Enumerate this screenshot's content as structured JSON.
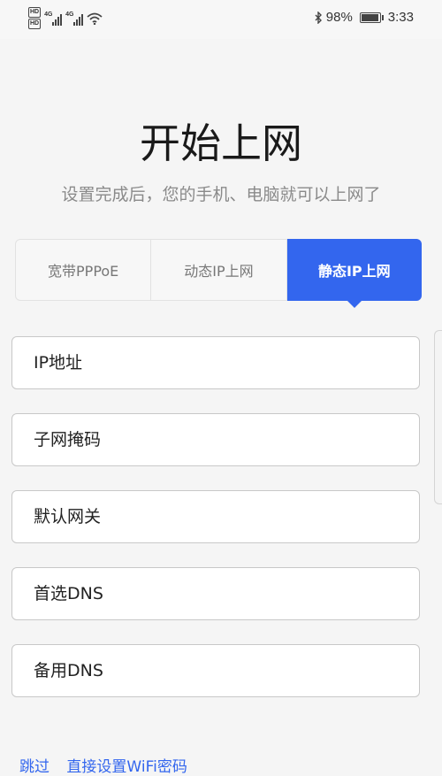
{
  "status_bar": {
    "hd1": "HD",
    "hd2": "HD",
    "net1": "4G",
    "net2": "4G",
    "battery_level": 0.98,
    "battery_text": "98%",
    "time": "3:33"
  },
  "header": {
    "title": "开始上网",
    "subtitle": "设置完成后，您的手机、电脑就可以上网了"
  },
  "tabs": [
    {
      "label": "宽带PPPoE",
      "active": false
    },
    {
      "label": "动态IP上网",
      "active": false
    },
    {
      "label": "静态IP上网",
      "active": true
    }
  ],
  "fields": {
    "ip_address": {
      "placeholder": "IP地址",
      "value": ""
    },
    "subnet_mask": {
      "placeholder": "子网掩码",
      "value": ""
    },
    "gateway": {
      "placeholder": "默认网关",
      "value": ""
    },
    "primary_dns": {
      "placeholder": "首选DNS",
      "value": ""
    },
    "backup_dns": {
      "placeholder": "备用DNS",
      "value": ""
    }
  },
  "footer": {
    "skip": "跳过",
    "set_wifi": "直接设置WiFi密码"
  },
  "colors": {
    "accent": "#3366ee",
    "background": "#f5f5f5",
    "subtitle": "#8a8a8a"
  }
}
